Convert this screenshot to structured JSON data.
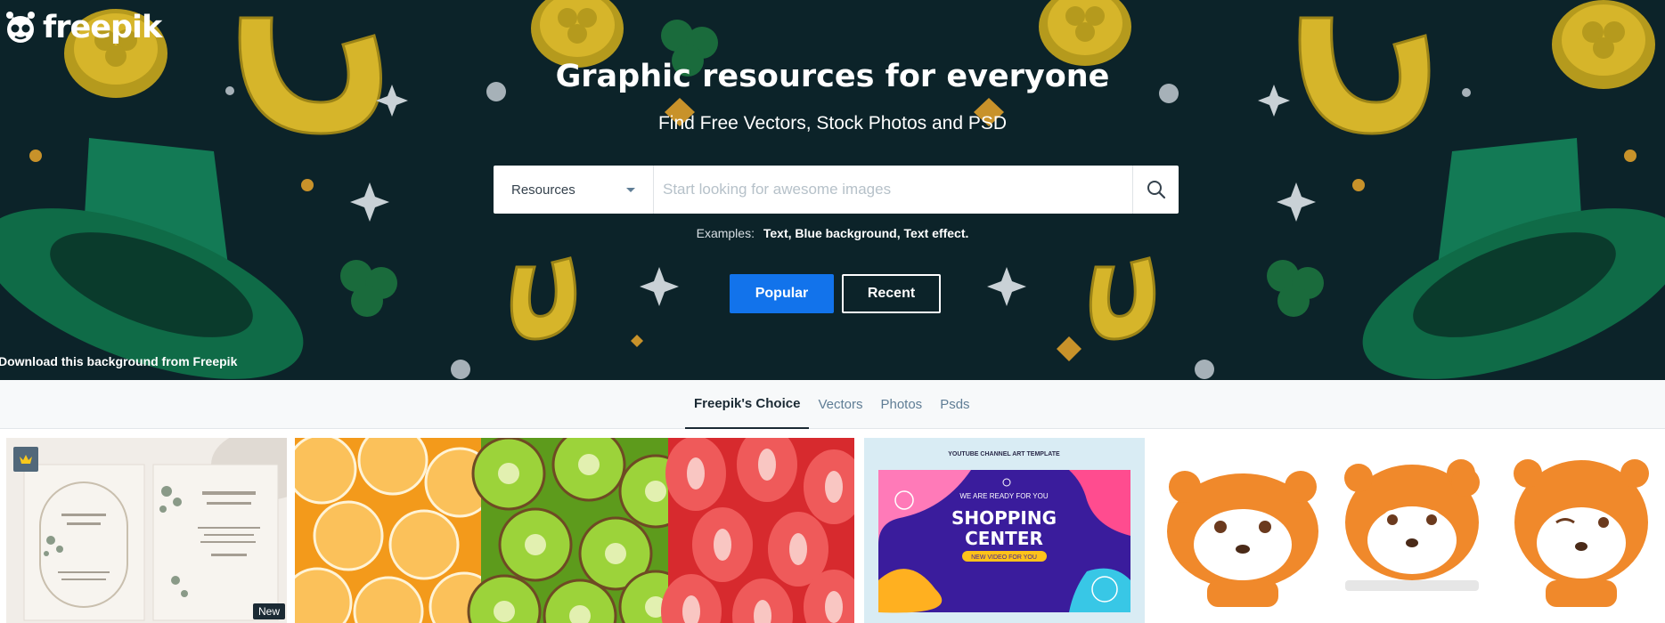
{
  "brand": {
    "name": "freepik"
  },
  "hero": {
    "title": "Graphic resources for everyone",
    "subtitle": "Find Free Vectors, Stock Photos and PSD",
    "credit": "Download this background from Freepik",
    "background_color": "#0c2329"
  },
  "search": {
    "selected_resource": "Resources",
    "placeholder": "Start looking for awesome images",
    "value": "",
    "icon": "search-icon"
  },
  "examples": {
    "label": "Examples:",
    "links": [
      "Text,",
      "Blue background,",
      "Text effect."
    ]
  },
  "buttons": {
    "popular": "Popular",
    "recent": "Recent",
    "popular_color": "#1273eb"
  },
  "tabs": [
    {
      "label": "Freepik's Choice",
      "active": true
    },
    {
      "label": "Vectors",
      "active": false
    },
    {
      "label": "Photos",
      "active": false
    },
    {
      "label": "Psds",
      "active": false
    }
  ],
  "gallery": {
    "items": [
      {
        "name": "wedding-invitation-card",
        "premium": true,
        "badge": "New"
      },
      {
        "name": "fruit-slices-pattern",
        "premium": false
      },
      {
        "name": "youtube-channel-art-template",
        "header": "YOUTUBE CHANNEL ART TEMPLATE",
        "kicker": "WE ARE READY FOR YOU",
        "headline_1": "SHOPPING",
        "headline_2": "CENTER",
        "tagline": "NEW VIDEO FOR YOU"
      },
      {
        "name": "cartoon-tiger-stickers",
        "premium": false
      }
    ]
  }
}
